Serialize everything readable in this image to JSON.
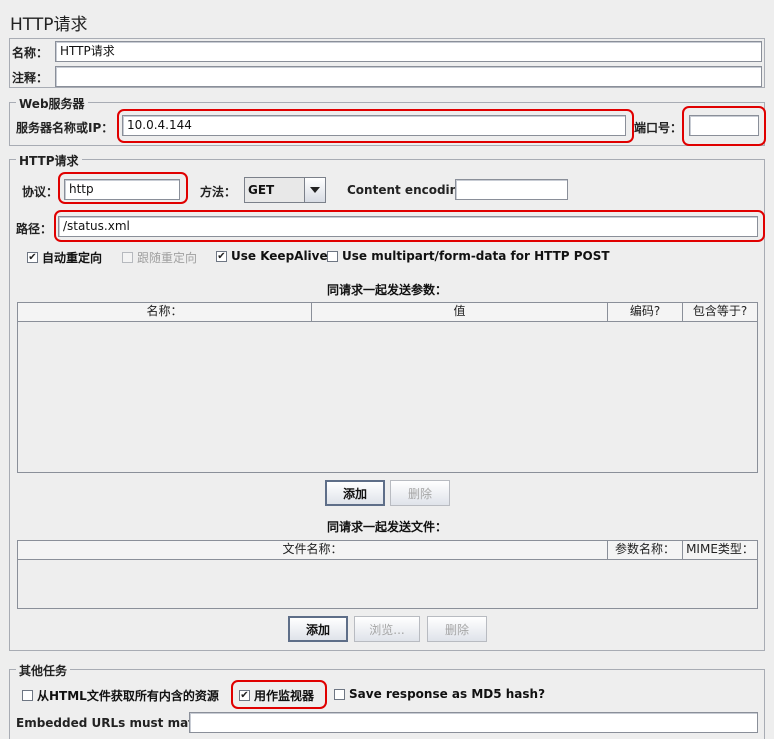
{
  "header": {
    "title": "HTTP请求"
  },
  "general": {
    "name_label": "名称：",
    "name_value": "HTTP请求",
    "comment_label": "注释："
  },
  "web_server": {
    "legend": "Web服务器",
    "server_label": "服务器名称或IP：",
    "server_value": "10.0.4.144",
    "port_label": "端口号："
  },
  "http_request": {
    "legend": "HTTP请求",
    "protocol_label": "协议：",
    "protocol_value": "http",
    "method_label": "方法：",
    "method_value": "GET",
    "encoding_label": "Content encoding:",
    "path_label": "路径：",
    "path_value": "/status.xml",
    "options": [
      {
        "label": "自动重定向",
        "checked": true,
        "enabled": true
      },
      {
        "label": "跟随重定向",
        "checked": false,
        "enabled": false
      },
      {
        "label": "Use KeepAlive",
        "checked": true,
        "enabled": true
      },
      {
        "label": "Use multipart/form-data for HTTP POST",
        "checked": false,
        "enabled": true
      }
    ]
  },
  "params": {
    "title": "同请求一起发送参数：",
    "columns": [
      "名称：",
      "值",
      "编码?",
      "包含等于?"
    ],
    "add_label": "添加",
    "delete_label": "删除"
  },
  "files": {
    "title": "同请求一起发送文件：",
    "columns": [
      "文件名称：",
      "参数名称：",
      "MIME类型："
    ],
    "add_label": "添加",
    "browse_label": "浏览...",
    "delete_label": "删除"
  },
  "other": {
    "legend": "其他任务",
    "options": [
      {
        "label": "从HTML文件获取所有内含的资源",
        "checked": false
      },
      {
        "label": "用作监视器",
        "checked": true
      },
      {
        "label": "Save response as MD5 hash?",
        "checked": false
      }
    ],
    "embedded_label": "Embedded URLs must match:"
  },
  "colors": {
    "highlight": "#e00000",
    "background": "#eeeeee"
  }
}
